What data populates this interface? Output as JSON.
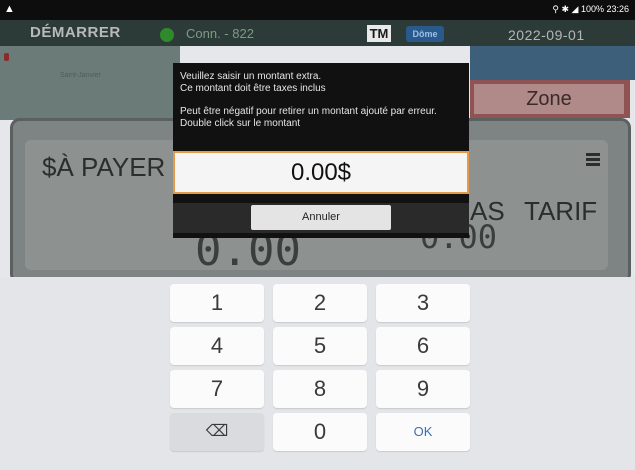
{
  "status_bar": {
    "warning_icon": "warning-icon",
    "right_text": "100% 23:26"
  },
  "header": {
    "brand": "DÉMARRER",
    "connection": "Conn. - 822",
    "tm_badge": "TM",
    "dome_badge": "Dôme",
    "date": "2022-09-01"
  },
  "background": {
    "map_label": "Saint-Janvier",
    "zone_button": "Zone",
    "pay_label": "$À PAYER",
    "as_label": "AS",
    "tarif_label": "TARIF",
    "big_amount": "0.00",
    "small_amount": "0.00"
  },
  "dialog": {
    "line1": "Veuillez saisir un montant extra.",
    "line2": "Ce montant doit être taxes inclus",
    "line3": "Peut être négatif pour retirer un montant ajouté par erreur. Double click sur le montant",
    "amount_value": "0.00$",
    "cancel_label": "Annuler"
  },
  "keypad": {
    "keys": [
      "1",
      "2",
      "3",
      "4",
      "5",
      "6",
      "7",
      "8",
      "9",
      "⌫",
      "0",
      "OK"
    ]
  }
}
